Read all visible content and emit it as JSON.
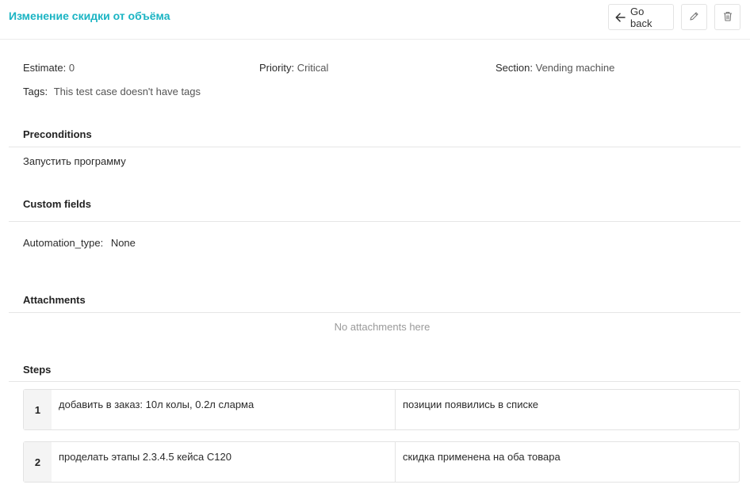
{
  "header": {
    "title": "Изменение скидки от объёма",
    "go_back_label": "Go back"
  },
  "meta": {
    "estimate_label": "Estimate:",
    "estimate_value": "0",
    "priority_label": "Priority:",
    "priority_value": "Critical",
    "section_label": "Section:",
    "section_value": "Vending machine",
    "tags_label": "Tags:",
    "tags_value": "This test case doesn't have tags"
  },
  "preconditions": {
    "title": "Preconditions",
    "text": "Запустить программу"
  },
  "custom_fields": {
    "title": "Custom fields",
    "automation_label": "Automation_type:",
    "automation_value": "None"
  },
  "attachments": {
    "title": "Attachments",
    "empty_text": "No attachments here"
  },
  "steps": {
    "title": "Steps",
    "items": [
      {
        "num": "1",
        "action": "добавить в заказ: 10л колы, 0.2л слармa",
        "result": "позиции появились в списке"
      },
      {
        "num": "2",
        "action": "проделать этапы 2.3.4.5 кейса С120",
        "result": "скидка применена на оба товара"
      }
    ]
  },
  "icons": {
    "back": "arrow-left-icon",
    "edit": "pencil-icon",
    "delete": "trash-icon"
  },
  "colors": {
    "accent": "#1ab4c3"
  }
}
